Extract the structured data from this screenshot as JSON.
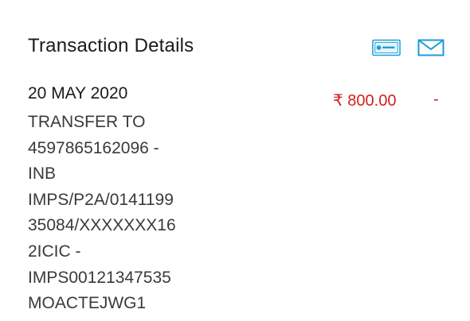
{
  "header": {
    "title": "Transaction Details",
    "icons": [
      "card-statement-icon",
      "mail-icon"
    ],
    "icon_color": "#1a9ed8"
  },
  "transaction": {
    "date": "20 MAY 2020",
    "description_lines": [
      "TRANSFER TO",
      "4597865162096 -",
      "INB",
      "IMPS/P2A/0141199",
      "35084/XXXXXXX16",
      "2ICIC -",
      "IMPS00121347535",
      "MOACTEJWG1"
    ],
    "amount": "₹ 800.00",
    "balance": "-",
    "amount_color": "#d0211c"
  }
}
